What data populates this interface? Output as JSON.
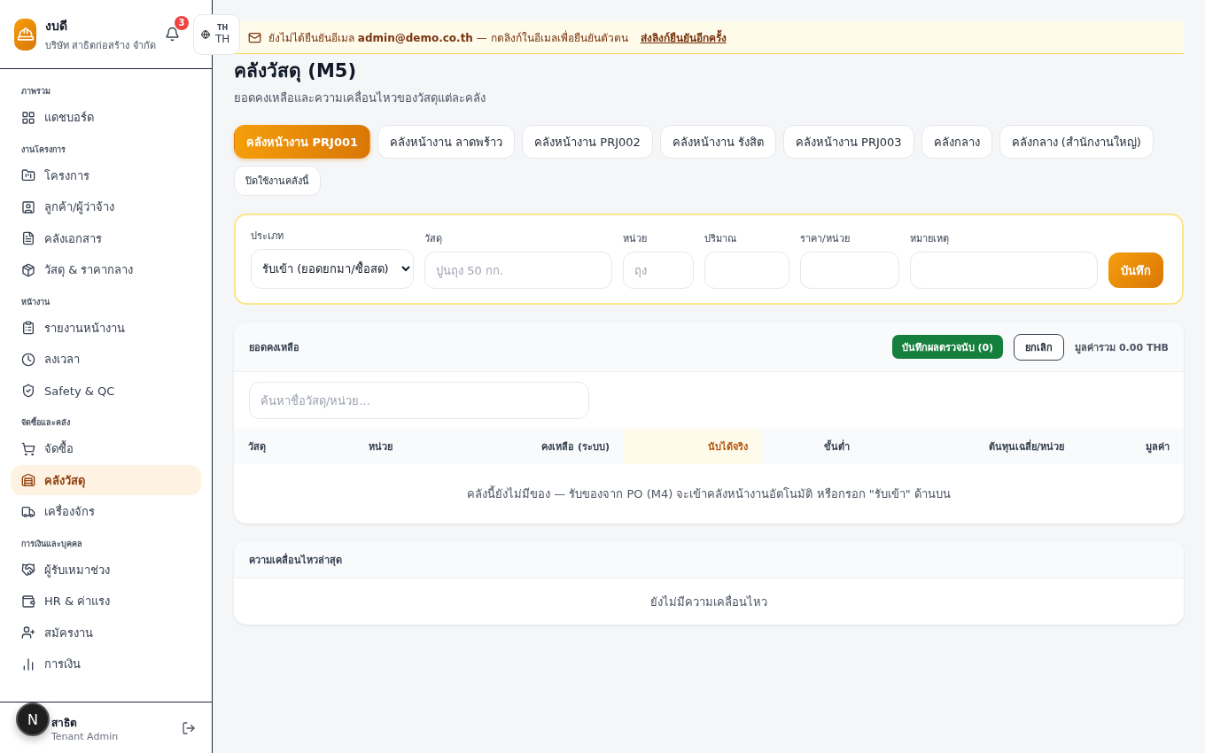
{
  "brand": {
    "name": "งบดี",
    "company": "บริษัท สาธิตก่อสร้าง จำกัด"
  },
  "notifications": {
    "count": "3"
  },
  "language": {
    "code": "TH",
    "label": "TH"
  },
  "sidebar": {
    "sections": [
      {
        "title": "ภาพรวม",
        "items": [
          {
            "label": "แดชบอร์ด",
            "selected": false
          }
        ]
      },
      {
        "title": "งานโครงการ",
        "items": [
          {
            "label": "โครงการ",
            "selected": false
          },
          {
            "label": "ลูกค้า/ผู้ว่าจ้าง",
            "selected": false
          },
          {
            "label": "คลังเอกสาร",
            "selected": false
          },
          {
            "label": "วัสดุ & ราคากลาง",
            "selected": false
          }
        ]
      },
      {
        "title": "หน้างาน",
        "items": [
          {
            "label": "รายงานหน้างาน",
            "selected": false
          },
          {
            "label": "ลงเวลา",
            "selected": false
          },
          {
            "label": "Safety & QC",
            "selected": false
          }
        ]
      },
      {
        "title": "จัดซื้อและคลัง",
        "items": [
          {
            "label": "จัดซื้อ",
            "selected": false
          },
          {
            "label": "คลังวัสดุ",
            "selected": true
          },
          {
            "label": "เครื่องจักร",
            "selected": false
          }
        ]
      },
      {
        "title": "การเงินและบุคคล",
        "items": [
          {
            "label": "ผู้รับเหมาช่วง",
            "selected": false
          },
          {
            "label": "HR & ค่าแรง",
            "selected": false
          },
          {
            "label": "สมัครงาน",
            "selected": false
          },
          {
            "label": "การเงิน",
            "selected": false
          }
        ]
      }
    ]
  },
  "user": {
    "name": "สาธิต",
    "role": "Tenant Admin",
    "avatar": "N"
  },
  "banner": {
    "message": "ยังไม่ได้ยืนยันอีเมล **admin@demo.co.th** — กดลิงก์ในอีเมลเพื่อยืนยันตัวตน",
    "link": "ส่งลิงก์ยืนยันอีกครั้ง"
  },
  "page": {
    "title": "คลังวัสดุ (M5)",
    "subtitle": "ยอดคงเหลือและความเคลื่อนไหวของวัสดุแต่ละคลัง"
  },
  "warehouse_tabs": [
    {
      "label": "คลังหน้างาน PRJ001",
      "selected": true
    },
    {
      "label": "คลังหน้างาน ลาดพร้าว",
      "selected": false
    },
    {
      "label": "คลังหน้างาน PRJ002",
      "selected": false
    },
    {
      "label": "คลังหน้างาน รังสิต",
      "selected": false
    },
    {
      "label": "คลังหน้างาน PRJ003",
      "selected": false
    },
    {
      "label": "คลังกลาง",
      "selected": false
    },
    {
      "label": "คลังกลาง (สำนักงานใหญ่)",
      "selected": false
    }
  ],
  "disable_button": "ปิดใช้งานคลังนี้",
  "entry_form": {
    "fields": [
      {
        "kind": "select",
        "label": "ประเภท",
        "value": "รับเข้า (ยอดยกมา/ซื้อสด)"
      },
      {
        "kind": "input",
        "label": "วัสดุ",
        "placeholder": "ปูนถุง 50 กก."
      },
      {
        "kind": "input",
        "label": "หน่วย",
        "placeholder": "ถุง"
      },
      {
        "kind": "input",
        "label": "ปริมาณ"
      },
      {
        "kind": "input",
        "label": "ราคา/หน่วย"
      },
      {
        "kind": "input",
        "label": "หมายเหตุ"
      }
    ],
    "submit": "บันทึก"
  },
  "balance": {
    "title": "ยอดคงเหลือ",
    "save_count_button": "บันทึกผลตรวจนับ (0)",
    "cancel_button": "ยกเลิก",
    "total": "มูลค่ารวม 0.00 THB",
    "search": {
      "placeholder": "ค้นหาชื่อวัสดุ/หน่วย..."
    },
    "columns": [
      {
        "label": "วัสดุ",
        "highlighted": false
      },
      {
        "label": "หน่วย",
        "highlighted": false
      },
      {
        "label": "คงเหลือ (ระบบ)",
        "highlighted": false
      },
      {
        "label": "นับได้จริง",
        "highlighted": true
      },
      {
        "label": "ขั้นต่ำ",
        "highlighted": false
      },
      {
        "label": "ต้นทุนเฉลี่ย/หน่วย",
        "highlighted": false
      },
      {
        "label": "มูลค่า",
        "highlighted": false
      }
    ],
    "empty": "คลังนี้ยังไม่มีของ — รับของจาก PO (M4) จะเข้าคลังหน้างานอัตโนมัติ หรือกรอก \"รับเข้า\" ด้านบน"
  },
  "movements": {
    "title": "ความเคลื่อนไหวล่าสุด",
    "empty": "ยังไม่มีความเคลื่อนไหว"
  }
}
